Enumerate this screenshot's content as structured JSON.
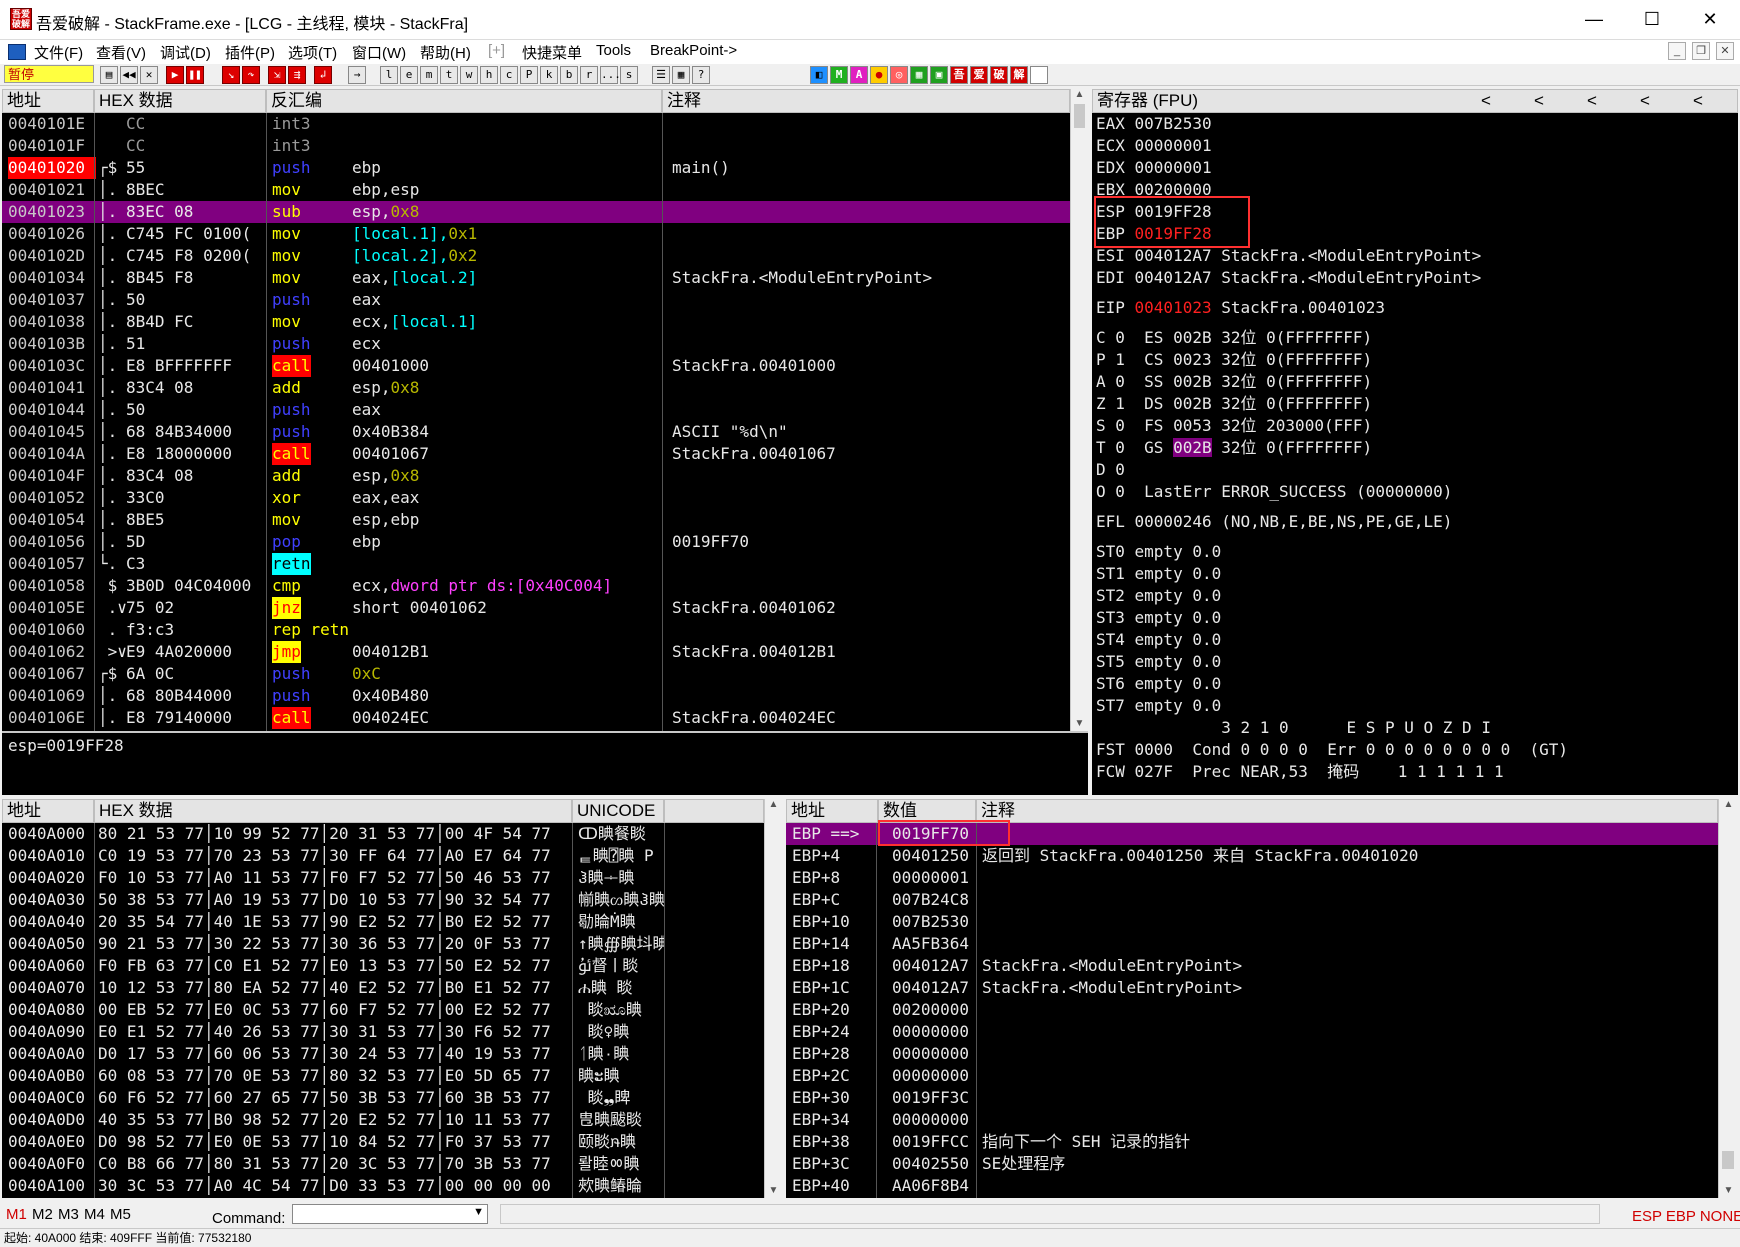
{
  "window": {
    "title": "吾爱破解 - StackFrame.exe - [LCG - 主线程, 模块 - StackFra]",
    "icon_label": "吾爱破解",
    "minimize": "—",
    "maximize": "☐",
    "close": "✕"
  },
  "menu": [
    "文件(F)",
    "查看(V)",
    "调试(D)",
    "插件(P)",
    "选项(T)",
    "窗口(W)",
    "帮助(H)",
    "[+]",
    "快捷菜单",
    "Tools",
    "BreakPoint->"
  ],
  "toolbar": {
    "status": "暂停",
    "letters": [
      "l",
      "e",
      "m",
      "t",
      "w",
      "h",
      "c",
      "P",
      "k",
      "b",
      "r",
      "...",
      "s"
    ],
    "colored": [
      "M",
      "A",
      "吾",
      "爱",
      "破",
      "解"
    ]
  },
  "disasm": {
    "headers": [
      "地址",
      "HEX 数据",
      "反汇编",
      "注释"
    ],
    "rows": [
      {
        "addr": "0040101E",
        "mark": "",
        "hex": "CC",
        "op": "int3",
        "args": "",
        "cmt": ""
      },
      {
        "addr": "0040101F",
        "mark": "",
        "hex": "CC",
        "op": "int3",
        "args": "",
        "cmt": ""
      },
      {
        "addr": "00401020",
        "mark": "┌$",
        "hex": "55",
        "op": "push",
        "args": "ebp",
        "cmt": "main()"
      },
      {
        "addr": "00401021",
        "mark": "│.",
        "hex": "8BEC",
        "op": "mov",
        "args": "ebp,esp",
        "cmt": ""
      },
      {
        "addr": "00401023",
        "mark": "│.",
        "hex": "83EC 08",
        "op": "sub",
        "args": "esp,0x8",
        "cmt": ""
      },
      {
        "addr": "00401026",
        "mark": "│.",
        "hex": "C745 FC 0100(",
        "op": "mov",
        "args": "[local.1],0x1",
        "cmt": ""
      },
      {
        "addr": "0040102D",
        "mark": "│.",
        "hex": "C745 F8 0200(",
        "op": "mov",
        "args": "[local.2],0x2",
        "cmt": ""
      },
      {
        "addr": "00401034",
        "mark": "│.",
        "hex": "8B45 F8",
        "op": "mov",
        "args": "eax,[local.2]",
        "cmt": "StackFra.<ModuleEntryPoint>"
      },
      {
        "addr": "00401037",
        "mark": "│.",
        "hex": "50",
        "op": "push",
        "args": "eax",
        "cmt": ""
      },
      {
        "addr": "00401038",
        "mark": "│.",
        "hex": "8B4D FC",
        "op": "mov",
        "args": "ecx,[local.1]",
        "cmt": ""
      },
      {
        "addr": "0040103B",
        "mark": "│.",
        "hex": "51",
        "op": "push",
        "args": "ecx",
        "cmt": ""
      },
      {
        "addr": "0040103C",
        "mark": "│.",
        "hex": "E8 BFFFFFFF",
        "op": "call",
        "args": "00401000",
        "cmt": "StackFra.00401000"
      },
      {
        "addr": "00401041",
        "mark": "│.",
        "hex": "83C4 08",
        "op": "add",
        "args": "esp,0x8",
        "cmt": ""
      },
      {
        "addr": "00401044",
        "mark": "│.",
        "hex": "50",
        "op": "push",
        "args": "eax",
        "cmt": ""
      },
      {
        "addr": "00401045",
        "mark": "│.",
        "hex": "68 84B34000",
        "op": "push",
        "args": "0x40B384",
        "cmt": "ASCII \"%d\\n\""
      },
      {
        "addr": "0040104A",
        "mark": "│.",
        "hex": "E8 18000000",
        "op": "call",
        "args": "00401067",
        "cmt": "StackFra.00401067"
      },
      {
        "addr": "0040104F",
        "mark": "│.",
        "hex": "83C4 08",
        "op": "add",
        "args": "esp,0x8",
        "cmt": ""
      },
      {
        "addr": "00401052",
        "mark": "│.",
        "hex": "33C0",
        "op": "xor",
        "args": "eax,eax",
        "cmt": ""
      },
      {
        "addr": "00401054",
        "mark": "│.",
        "hex": "8BE5",
        "op": "mov",
        "args": "esp,ebp",
        "cmt": ""
      },
      {
        "addr": "00401056",
        "mark": "│.",
        "hex": "5D",
        "op": "pop",
        "args": "ebp",
        "cmt": "0019FF70"
      },
      {
        "addr": "00401057",
        "mark": "└.",
        "hex": "C3",
        "op": "retn",
        "args": "",
        "cmt": ""
      },
      {
        "addr": "00401058",
        "mark": " $",
        "hex": "3B0D 04C04000",
        "op": "cmp",
        "args": "ecx,dword ptr ds:[0x40C004]",
        "cmt": ""
      },
      {
        "addr": "0040105E",
        "mark": " .∨",
        "hex": "75 02",
        "op": "jnz",
        "args": "short 00401062",
        "cmt": "StackFra.00401062"
      },
      {
        "addr": "00401060",
        "mark": " .",
        "hex": "f3:c3",
        "op": "rep retn",
        "args": "",
        "cmt": ""
      },
      {
        "addr": "00401062",
        "mark": " >∨",
        "hex": "E9 4A020000",
        "op": "jmp",
        "args": "004012B1",
        "cmt": "StackFra.004012B1"
      },
      {
        "addr": "00401067",
        "mark": "┌$",
        "hex": "6A 0C",
        "op": "push",
        "args": "0xC",
        "cmt": ""
      },
      {
        "addr": "00401069",
        "mark": "│.",
        "hex": "68 80B44000",
        "op": "push",
        "args": "0x40B480",
        "cmt": ""
      },
      {
        "addr": "0040106E",
        "mark": "│.",
        "hex": "E8 79140000",
        "op": "call",
        "args": "004024EC",
        "cmt": "StackFra.004024EC"
      }
    ],
    "info": "esp=0019FF28"
  },
  "registers": {
    "header": "寄存器 (FPU)",
    "arrows": [
      "<",
      "<",
      "<",
      "<",
      "<",
      "<"
    ],
    "lines": [
      {
        "k": "gp",
        "name": "EAX",
        "val": "007B2530",
        "extra": ""
      },
      {
        "k": "gp",
        "name": "ECX",
        "val": "00000001",
        "extra": ""
      },
      {
        "k": "gp",
        "name": "EDX",
        "val": "00000001",
        "extra": ""
      },
      {
        "k": "gp",
        "name": "EBX",
        "val": "00200000",
        "extra": ""
      },
      {
        "k": "gp",
        "name": "ESP",
        "val": "0019FF28",
        "extra": ""
      },
      {
        "k": "gp",
        "name": "EBP",
        "val": "0019FF28",
        "extra": ""
      },
      {
        "k": "gp",
        "name": "ESI",
        "val": "004012A7",
        "extra": "StackFra.<ModuleEntryPoint>"
      },
      {
        "k": "gp",
        "name": "EDI",
        "val": "004012A7",
        "extra": "StackFra.<ModuleEntryPoint>"
      }
    ],
    "eip": {
      "name": "EIP",
      "val": "00401023",
      "extra": "StackFra.00401023"
    },
    "flags": [
      {
        "f": "C 0",
        "seg": "ES",
        "sv": "002B",
        "bits": "32位",
        "lim": "0(FFFFFFFF)"
      },
      {
        "f": "P 1",
        "seg": "CS",
        "sv": "0023",
        "bits": "32位",
        "lim": "0(FFFFFFFF)"
      },
      {
        "f": "A 0",
        "seg": "SS",
        "sv": "002B",
        "bits": "32位",
        "lim": "0(FFFFFFFF)"
      },
      {
        "f": "Z 1",
        "seg": "DS",
        "sv": "002B",
        "bits": "32位",
        "lim": "0(FFFFFFFF)"
      },
      {
        "f": "S 0",
        "seg": "FS",
        "sv": "0053",
        "bits": "32位",
        "lim": "203000(FFF)"
      },
      {
        "f": "T 0",
        "seg": "GS",
        "sv": "002B",
        "bits": "32位",
        "lim": "0(FFFFFFFF)"
      },
      {
        "f": "D 0",
        "seg": "",
        "sv": "",
        "bits": "",
        "lim": ""
      },
      {
        "f": "O 0",
        "seg": "LastErr",
        "sv": "ERROR_SUCCESS",
        "bits": "(00000000)",
        "lim": ""
      }
    ],
    "efl": "EFL 00000246 (NO,NB,E,BE,NS,PE,GE,LE)",
    "st": [
      "ST0 empty 0.0",
      "ST1 empty 0.0",
      "ST2 empty 0.0",
      "ST3 empty 0.0",
      "ST4 empty 0.0",
      "ST5 empty 0.0",
      "ST6 empty 0.0",
      "ST7 empty 0.0"
    ],
    "fpu_bits": "             3 2 1 0      E S P U O Z D I",
    "fst": "FST 0000  Cond 0 0 0 0  Err 0 0 0 0 0 0 0 0  (GT)",
    "fcw": "FCW 027F  Prec NEAR,53  掩码    1 1 1 1 1 1"
  },
  "dump": {
    "headers": [
      "地址",
      "HEX 数据",
      "UNICODE"
    ],
    "rows": [
      {
        "a": "0040A000",
        "h": "80 21 53 77│10 99 52 77│20 31 53 77│00 4F 54 77",
        "u": "ↀ睓餐睒"
      },
      {
        "a": "0040A010",
        "h": "C0 19 53 77│70 23 53 77│30 FF 64 77│A0 E7 64 77",
        "u": "ᇀ睓⍰睓 P"
      },
      {
        "a": "0040A020",
        "h": "F0 10 53 77│A0 11 53 77│F0 F7 52 77│50 46 53 77",
        "u": "ჰ睓ᆠ睓"
      },
      {
        "a": "0040A030",
        "h": "50 38 53 77│A0 19 53 77│D0 10 53 77│90 32 54 77",
        "u": "㡐睓ᦠ睓ჰ睓"
      },
      {
        "a": "0040A040",
        "h": "20 35 54 77│40 1E 53 77│90 E2 52 77│B0 E2 52 77",
        "u": "㔠睔Ṁ睓"
      },
      {
        "a": "0040A050",
        "h": "90 21 53 77│30 22 53 77│30 36 53 77│20 0F 53 77",
        "u": "↑睓∰睓㘰睓"
      },
      {
        "a": "0040A060",
        "h": "F0 FB 63 77│C0 E1 52 77│E0 13 53 77│50 E2 52 77",
        "u": "ﯰ督ￜ睒"
      },
      {
        "a": "0040A070",
        "h": "10 12 53 77│80 EA 52 77│40 E2 52 77│B0 E1 52 77",
        "u": "ሐ睓 睒"
      },
      {
        "a": "0040A080",
        "h": "00 EB 52 77│E0 0C 53 77│60 F7 52 77│00 E2 52 77",
        "u": " 睒ೠ睓"
      },
      {
        "a": "0040A090",
        "h": "E0 E1 52 77│40 26 53 77│30 31 53 77│30 F6 52 77",
        "u": " 睒♀睓"
      },
      {
        "a": "0040A0A0",
        "h": "D0 17 53 77│60 06 53 77│30 24 53 77│40 19 53 77",
        "u": "ᛐ睓٠睓"
      },
      {
        "a": "0040A0B0",
        "h": "60 08 53 77│70 0E 53 77│80 32 53 77│E0 5D 65 77",
        "u": "ࡠ睓ະ睓"
      },
      {
        "a": "0040A0C0",
        "h": "60 F6 52 77│60 27 65 77│50 3B 53 77│60 3B 53 77",
        "u": " 睒❠睥"
      },
      {
        "a": "0040A0D0",
        "h": "40 35 53 77│B0 98 52 77│20 E2 52 77│10 11 53 77",
        "u": "㕀睓颰睒"
      },
      {
        "a": "0040A0E0",
        "h": "D0 98 52 77│E0 0E 53 77│10 84 52 77│F0 37 53 77",
        "u": "颐睒ໞ睓"
      },
      {
        "a": "0040A0F0",
        "h": "C0 B8 66 77│80 31 53 77│20 3C 53 77│70 3B 53 77",
        "u": "뢀睦ㆀ睓"
      },
      {
        "a": "0040A100",
        "h": "30 3C 53 77│A0 4C 54 77│D0 33 53 77│00 00 00 00",
        "u": "㰰睓䲠睔"
      }
    ]
  },
  "stack": {
    "headers": [
      "地址",
      "数值",
      "注释"
    ],
    "rows": [
      {
        "a": "EBP ==>",
        "v": "0019FF70",
        "c": ""
      },
      {
        "a": "EBP+4",
        "v": "00401250",
        "c": "返回到 StackFra.00401250 来自 StackFra.00401020"
      },
      {
        "a": "EBP+8",
        "v": "00000001",
        "c": ""
      },
      {
        "a": "EBP+C",
        "v": "007B24C8",
        "c": ""
      },
      {
        "a": "EBP+10",
        "v": "007B2530",
        "c": ""
      },
      {
        "a": "EBP+14",
        "v": "AA5FB364",
        "c": ""
      },
      {
        "a": "EBP+18",
        "v": "004012A7",
        "c": "StackFra.<ModuleEntryPoint>"
      },
      {
        "a": "EBP+1C",
        "v": "004012A7",
        "c": "StackFra.<ModuleEntryPoint>"
      },
      {
        "a": "EBP+20",
        "v": "00200000",
        "c": ""
      },
      {
        "a": "EBP+24",
        "v": "00000000",
        "c": ""
      },
      {
        "a": "EBP+28",
        "v": "00000000",
        "c": ""
      },
      {
        "a": "EBP+2C",
        "v": "00000000",
        "c": ""
      },
      {
        "a": "EBP+30",
        "v": "0019FF3C",
        "c": ""
      },
      {
        "a": "EBP+34",
        "v": "00000000",
        "c": ""
      },
      {
        "a": "EBP+38",
        "v": "0019FFCC",
        "c": "指向下一个 SEH 记录的指针"
      },
      {
        "a": "EBP+3C",
        "v": "00402550",
        "c": "SE处理程序"
      },
      {
        "a": "EBP+40",
        "v": "AA06F8B4",
        "c": ""
      }
    ]
  },
  "bottom": {
    "mtabs": [
      "M1",
      "M2",
      "M3",
      "M4",
      "M5"
    ],
    "command_label": "Command:",
    "command_value": "",
    "right": "ESP EBP NONE",
    "status": "起始: 40A000 结束: 409FFF 当前值: 77532180"
  }
}
